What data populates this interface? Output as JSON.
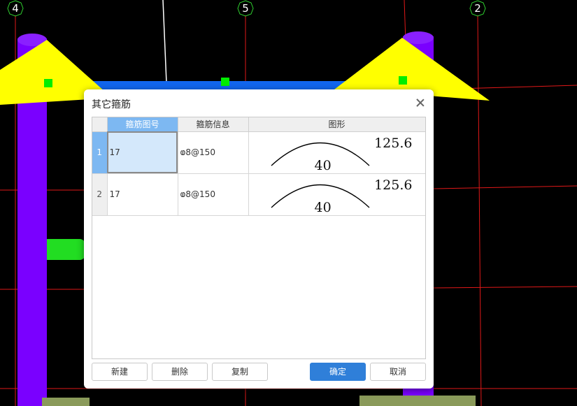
{
  "axis_labels": [
    "4",
    "5",
    "2"
  ],
  "dialog": {
    "title": "其它箍筋",
    "columns": [
      "",
      "箍筋图号",
      "箍筋信息",
      "图形"
    ],
    "rows": [
      {
        "index": "1",
        "number": "17",
        "info": "ⱷ8@150",
        "shape_top": "125.6",
        "shape_bottom": "40"
      },
      {
        "index": "2",
        "number": "17",
        "info": "ⱷ8@150",
        "shape_top": "125.6",
        "shape_bottom": "40"
      }
    ],
    "buttons": {
      "new": "新建",
      "delete": "删除",
      "copy": "复制",
      "ok": "确定",
      "cancel": "取消"
    }
  },
  "colors": {
    "column": "#7a00ff",
    "roof": "#ffff00",
    "beam": "#1166ee",
    "grip": "#00ee00",
    "grid_line": "#ff2020",
    "accent": "#2f7fd9",
    "selected_header": "#7db8f2"
  }
}
